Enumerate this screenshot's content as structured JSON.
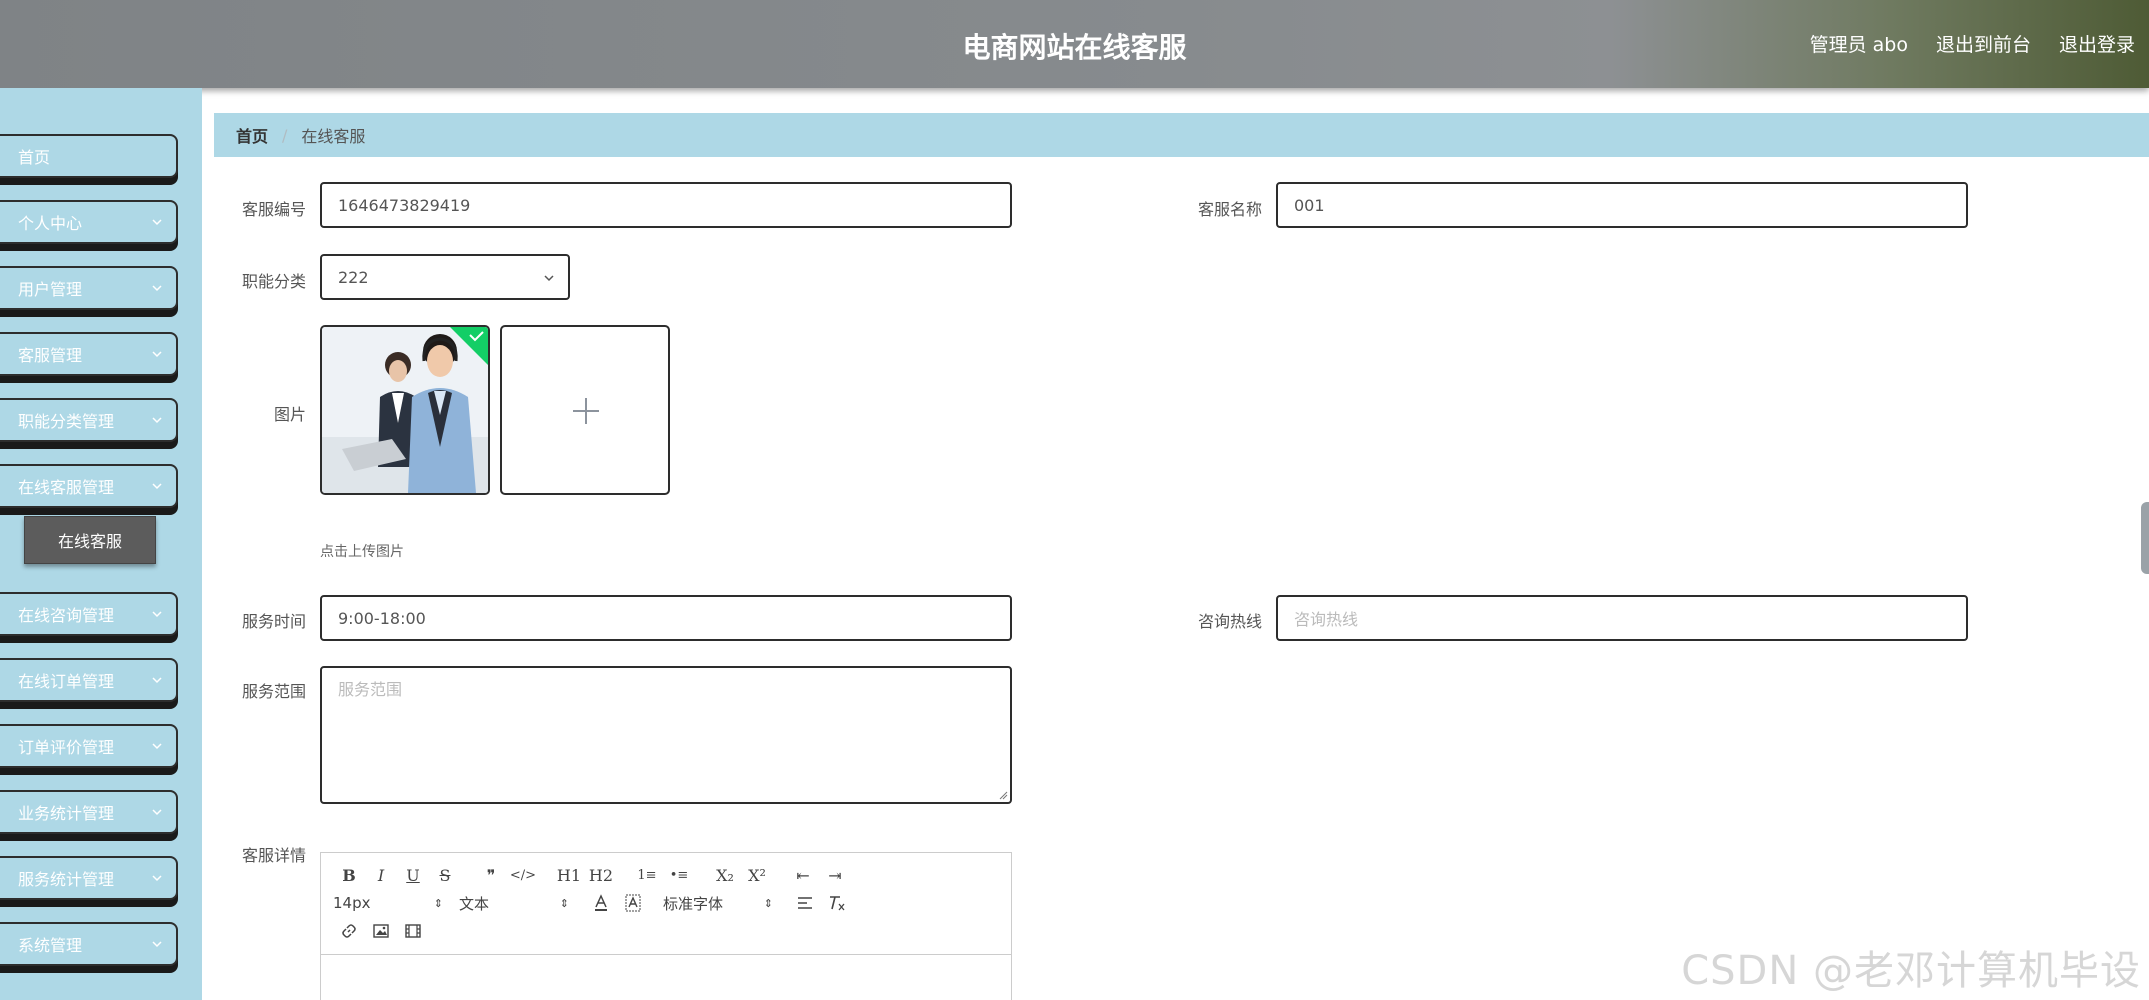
{
  "header": {
    "title": "电商网站在线客服",
    "user_label": "管理员 abo",
    "to_front": "退出到前台",
    "logout": "退出登录"
  },
  "sidebar": {
    "items": [
      {
        "label": "首页",
        "has_children": false
      },
      {
        "label": "个人中心",
        "has_children": true
      },
      {
        "label": "用户管理",
        "has_children": true
      },
      {
        "label": "客服管理",
        "has_children": true
      },
      {
        "label": "职能分类管理",
        "has_children": true
      },
      {
        "label": "在线客服管理",
        "has_children": true
      },
      {
        "label": "在线咨询管理",
        "has_children": true
      },
      {
        "label": "在线订单管理",
        "has_children": true
      },
      {
        "label": "订单评价管理",
        "has_children": true
      },
      {
        "label": "业务统计管理",
        "has_children": true
      },
      {
        "label": "服务统计管理",
        "has_children": true
      },
      {
        "label": "系统管理",
        "has_children": true
      }
    ],
    "active_sub": "在线客服"
  },
  "breadcrumb": {
    "home": "首页",
    "separator": "/",
    "current": "在线客服"
  },
  "form": {
    "service_no": {
      "label": "客服编号",
      "value": "1646473829419"
    },
    "service_name": {
      "label": "客服名称",
      "value": "001"
    },
    "category": {
      "label": "职能分类",
      "value": "222"
    },
    "image": {
      "label": "图片",
      "hint": "点击上传图片"
    },
    "service_time": {
      "label": "服务时间",
      "value": "9:00-18:00"
    },
    "hotline": {
      "label": "咨询热线",
      "placeholder": "咨询热线"
    },
    "scope": {
      "label": "服务范围",
      "placeholder": "服务范围"
    },
    "detail": {
      "label": "客服详情"
    }
  },
  "editor": {
    "row1": [
      "B",
      "I",
      "U",
      "S",
      "❞",
      "</>",
      "H1",
      "H2",
      "1≡",
      "•≡",
      "X₂",
      "X²",
      "⇤",
      "⇥"
    ],
    "font_size": "14px",
    "block_type": "文本",
    "font_family": "标准字体"
  },
  "watermark": "CSDN @老邓计算机毕设",
  "colors": {
    "sidebar_bg": "#aed8e6",
    "header_bg": "#878b8e",
    "submenu_bg": "#5c5c5c",
    "upload_success": "#13ce66"
  }
}
